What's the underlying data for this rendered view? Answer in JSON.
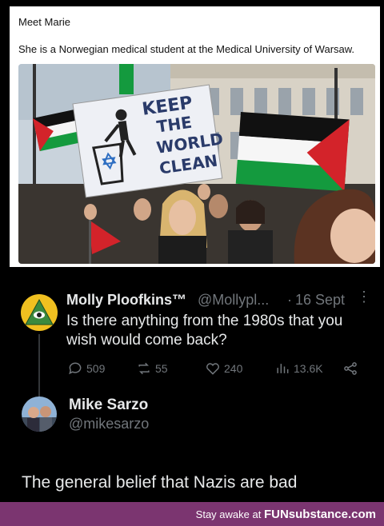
{
  "caption": {
    "line1": "Meet Marie",
    "line2": "She is a Norwegian medical student at the Medical University of Warsaw."
  },
  "photo": {
    "sign_lines": [
      "KEEP",
      "THE",
      "WORLD",
      "CLEAN"
    ]
  },
  "tweet": {
    "author_name": "Molly Ploofkins™",
    "author_handle": "@Mollypl...",
    "separator": "·",
    "date": "16 Sept",
    "more": "⋮",
    "text": "Is there anything from the 1980s that you wish would come back?",
    "replies": "509",
    "retweets": "55",
    "likes": "240",
    "views": "13.6K"
  },
  "reply": {
    "author_name": "Mike Sarzo",
    "author_handle": "@mikesarzo",
    "text": "The general belief that Nazis are bad"
  },
  "footer": {
    "prefix": "Stay awake at ",
    "brand": "FUNsubstance.com"
  },
  "colors": {
    "footer_bg": "#7b3570",
    "muted": "#71767b",
    "text": "#e7e9ea"
  }
}
